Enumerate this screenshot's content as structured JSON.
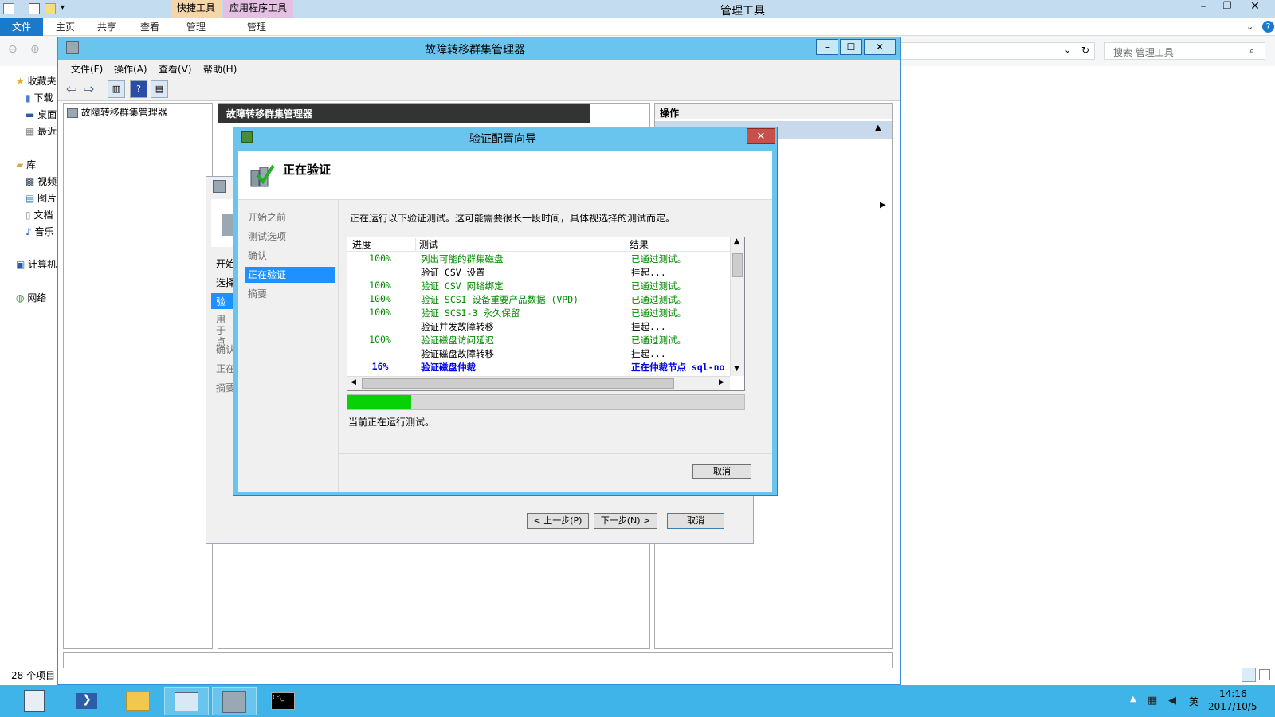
{
  "explorer": {
    "title": "管理工具",
    "context_tabs": [
      "快捷工具",
      "应用程序工具"
    ],
    "ribbon_tabs": [
      "文件",
      "主页",
      "共享",
      "查看",
      "管理",
      "管理"
    ],
    "search_placeholder": "搜索 管理工具",
    "nav_items": [
      "收藏夹",
      "下载",
      "桌面",
      "最近",
      "库",
      "视频",
      "图片",
      "文档",
      "音乐",
      "计算机",
      "网络"
    ],
    "status_count": "28 个项目"
  },
  "fcm": {
    "title": "故障转移群集管理器",
    "menu": [
      "文件(F)",
      "操作(A)",
      "查看(V)",
      "帮助(H)"
    ],
    "tree_root": "故障转移群集管理器",
    "center_header": "故障转移群集管理器",
    "actions_header": "操作"
  },
  "behind_wizard": {
    "steps": [
      "开始",
      "选择",
      "验证",
      "用于点",
      "确认",
      "正在",
      "摘要"
    ],
    "prev_button": "< 上一步(P)",
    "next_button": "下一步(N) >",
    "cancel_button": "取消"
  },
  "wizard": {
    "title": "验证配置向导",
    "heading": "正在验证",
    "steps": [
      "开始之前",
      "测试选项",
      "确认",
      "正在验证",
      "摘要"
    ],
    "active_step": 3,
    "description": "正在运行以下验证测试。这可能需要很长一段时间，具体视选择的测试而定。",
    "columns": [
      "进度",
      "测试",
      "结果"
    ],
    "rows": [
      {
        "progress": "100%",
        "test": "列出可能的群集磁盘",
        "result": "已通过测试。",
        "state": "passed"
      },
      {
        "progress": "",
        "test": "验证 CSV 设置",
        "result": "挂起...",
        "state": "pending"
      },
      {
        "progress": "100%",
        "test": "验证 CSV 网络绑定",
        "result": "已通过测试。",
        "state": "passed"
      },
      {
        "progress": "100%",
        "test": "验证 SCSI 设备重要产品数据 (VPD)",
        "result": "已通过测试。",
        "state": "passed"
      },
      {
        "progress": "100%",
        "test": "验证 SCSI-3 永久保留",
        "result": "已通过测试。",
        "state": "passed"
      },
      {
        "progress": "",
        "test": "验证并发故障转移",
        "result": "挂起...",
        "state": "pending"
      },
      {
        "progress": "100%",
        "test": "验证磁盘访问延迟",
        "result": "已通过测试。",
        "state": "passed"
      },
      {
        "progress": "",
        "test": "验证磁盘故障转移",
        "result": "挂起...",
        "state": "pending"
      },
      {
        "progress": "16%",
        "test": "验证磁盘仲裁",
        "result": "正在仲裁节点 sql-no",
        "state": "running"
      }
    ],
    "progress_fraction": 0.16,
    "status_text": "当前正在运行测试。",
    "cancel_button": "取消"
  },
  "taskbar": {
    "time": "14:16",
    "date": "2017/10/5",
    "ime": "英"
  },
  "colors": {
    "passed": "#008a00",
    "running": "#0000ee",
    "progress_fill": "#06d206",
    "title_bar": "#6ac5ee"
  }
}
